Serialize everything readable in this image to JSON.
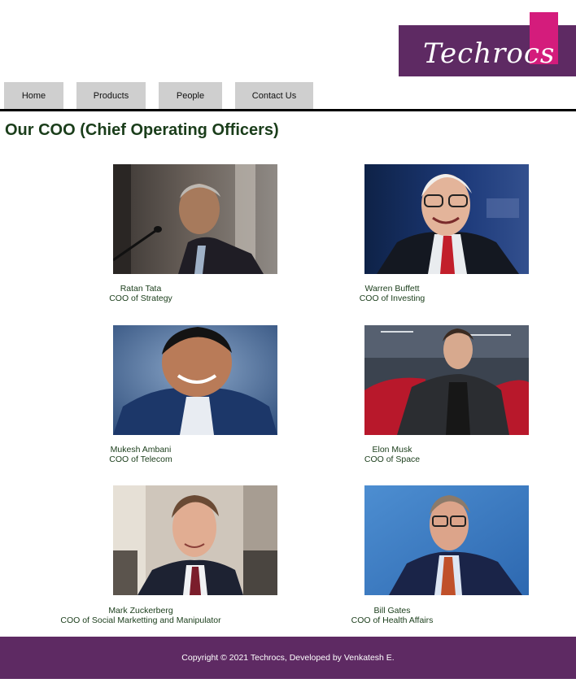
{
  "brand": {
    "name": "Techrocs",
    "primary_color": "#5e2a63",
    "accent_color": "#d41c7c"
  },
  "nav": {
    "items": [
      {
        "label": "Home"
      },
      {
        "label": "Products"
      },
      {
        "label": "People"
      },
      {
        "label": "Contact Us"
      }
    ]
  },
  "page": {
    "title": "Our COO (Chief Operating Officers)"
  },
  "people": [
    {
      "name": "Ratan Tata",
      "role": "COO of Strategy"
    },
    {
      "name": "Warren Buffett",
      "role": "COO of Investing"
    },
    {
      "name": "Mukesh Ambani",
      "role": "COO of Telecom"
    },
    {
      "name": "Elon Musk",
      "role": "COO of Space"
    },
    {
      "name": "Mark Zuckerberg",
      "role": "COO of Social Marketting and Manipulator"
    },
    {
      "name": "Bill Gates",
      "role": "COO of Health Affairs"
    }
  ],
  "footer": {
    "text": "Copyright © 2021 Techrocs, Developed by Venkatesh E."
  }
}
